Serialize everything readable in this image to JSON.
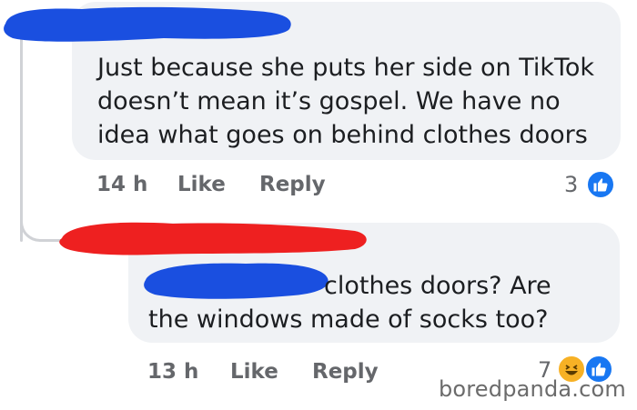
{
  "comments": [
    {
      "author": "",
      "text_lines": [
        "Just because she puts her side on TikTok",
        "doesn’t mean it’s gospel. We have no",
        "idea what goes on behind clothes doors"
      ],
      "time": "14 h",
      "like_label": "Like",
      "reply_label": "Reply",
      "reaction_count": "3",
      "reactions": [
        "like-icon"
      ]
    },
    {
      "author": "",
      "text_lines": [
        "clothes doors? Are",
        "the windows made of socks too?"
      ],
      "time": "13 h",
      "like_label": "Like",
      "reply_label": "Reply",
      "reaction_count": "7",
      "reactions": [
        "haha-icon",
        "like-icon"
      ]
    }
  ],
  "colors": {
    "bubble": "#f0f2f5",
    "meta_text": "#65676b",
    "like_blue": "#1877f2",
    "haha_yellow": "#f7b125",
    "redaction_blue": "#1a4fe0",
    "redaction_red": "#ee2020"
  },
  "watermark": "boredpanda.com"
}
